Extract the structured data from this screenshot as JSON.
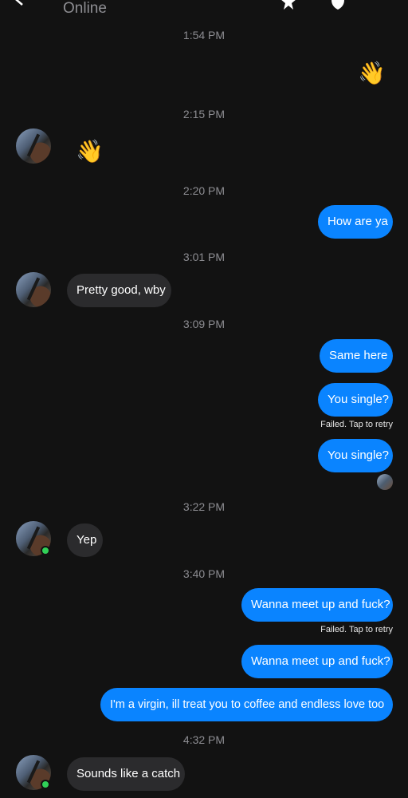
{
  "header": {
    "status": "Online"
  },
  "messages": [
    {
      "kind": "time",
      "text": "1:54 PM"
    },
    {
      "kind": "out_emoji",
      "text": "👋"
    },
    {
      "kind": "time",
      "text": "2:15 PM"
    },
    {
      "kind": "in_emoji",
      "text": "👋"
    },
    {
      "kind": "time",
      "text": "2:20 PM"
    },
    {
      "kind": "out",
      "text": "How are ya"
    },
    {
      "kind": "time",
      "text": "3:01 PM"
    },
    {
      "kind": "in",
      "text": "Pretty good, wby"
    },
    {
      "kind": "time",
      "text": "3:09 PM"
    },
    {
      "kind": "out",
      "text": "Same here"
    },
    {
      "kind": "out",
      "text": "You single?"
    },
    {
      "kind": "failed",
      "text": "Failed. Tap to retry"
    },
    {
      "kind": "out",
      "text": "You single?"
    },
    {
      "kind": "time",
      "text": "3:22 PM"
    },
    {
      "kind": "in",
      "text": "Yep"
    },
    {
      "kind": "time",
      "text": "3:40 PM"
    },
    {
      "kind": "out",
      "text": "Wanna meet up and fuck?"
    },
    {
      "kind": "failed",
      "text": "Failed. Tap to retry"
    },
    {
      "kind": "out",
      "text": "Wanna meet up and fuck?"
    },
    {
      "kind": "out",
      "text": "I'm a virgin, ill treat you to coffee and endless love too"
    },
    {
      "kind": "time",
      "text": "4:32 PM"
    },
    {
      "kind": "in",
      "text": "Sounds like a catch"
    }
  ]
}
